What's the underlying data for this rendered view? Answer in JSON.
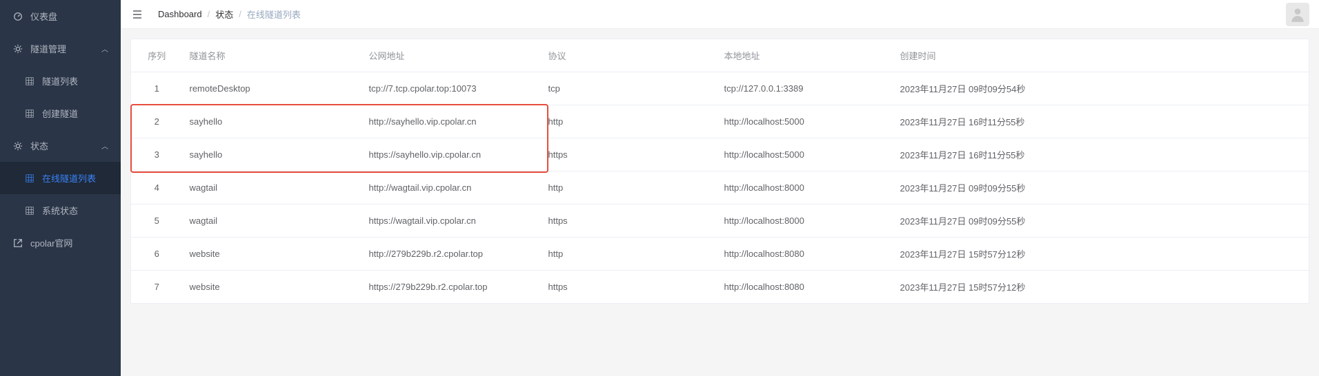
{
  "sidebar": {
    "items": [
      {
        "label": "仪表盘",
        "icon": "dashboard"
      },
      {
        "label": "隧道管理",
        "icon": "gear",
        "expandable": true
      },
      {
        "label": "隧道列表",
        "icon": "grid",
        "nested": true
      },
      {
        "label": "创建隧道",
        "icon": "grid",
        "nested": true
      },
      {
        "label": "状态",
        "icon": "gear",
        "expandable": true
      },
      {
        "label": "在线隧道列表",
        "icon": "grid",
        "nested": true,
        "active": true
      },
      {
        "label": "系统状态",
        "icon": "grid",
        "nested": true
      },
      {
        "label": "cpolar官网",
        "icon": "external"
      }
    ]
  },
  "breadcrumb": {
    "items": [
      {
        "label": "Dashboard"
      },
      {
        "label": "状态"
      },
      {
        "label": "在线隧道列表",
        "current": true
      }
    ]
  },
  "table": {
    "headers": {
      "seq": "序列",
      "name": "隧道名称",
      "url": "公网地址",
      "protocol": "协议",
      "local": "本地地址",
      "created": "创建时间"
    },
    "rows": [
      {
        "seq": "1",
        "name": "remoteDesktop",
        "url": "tcp://7.tcp.cpolar.top:10073",
        "protocol": "tcp",
        "local": "tcp://127.0.0.1:3389",
        "created": "2023年11月27日 09时09分54秒"
      },
      {
        "seq": "2",
        "name": "sayhello",
        "url": "http://sayhello.vip.cpolar.cn",
        "protocol": "http",
        "local": "http://localhost:5000",
        "created": "2023年11月27日 16时11分55秒"
      },
      {
        "seq": "3",
        "name": "sayhello",
        "url": "https://sayhello.vip.cpolar.cn",
        "protocol": "https",
        "local": "http://localhost:5000",
        "created": "2023年11月27日 16时11分55秒"
      },
      {
        "seq": "4",
        "name": "wagtail",
        "url": "http://wagtail.vip.cpolar.cn",
        "protocol": "http",
        "local": "http://localhost:8000",
        "created": "2023年11月27日 09时09分55秒"
      },
      {
        "seq": "5",
        "name": "wagtail",
        "url": "https://wagtail.vip.cpolar.cn",
        "protocol": "https",
        "local": "http://localhost:8000",
        "created": "2023年11月27日 09时09分55秒"
      },
      {
        "seq": "6",
        "name": "website",
        "url": "http://279b229b.r2.cpolar.top",
        "protocol": "http",
        "local": "http://localhost:8080",
        "created": "2023年11月27日 15时57分12秒"
      },
      {
        "seq": "7",
        "name": "website",
        "url": "https://279b229b.r2.cpolar.top",
        "protocol": "https",
        "local": "http://localhost:8080",
        "created": "2023年11月27日 15时57分12秒"
      }
    ]
  },
  "highlight": {
    "rows": [
      1,
      2
    ],
    "cols": [
      0,
      1,
      2
    ]
  }
}
